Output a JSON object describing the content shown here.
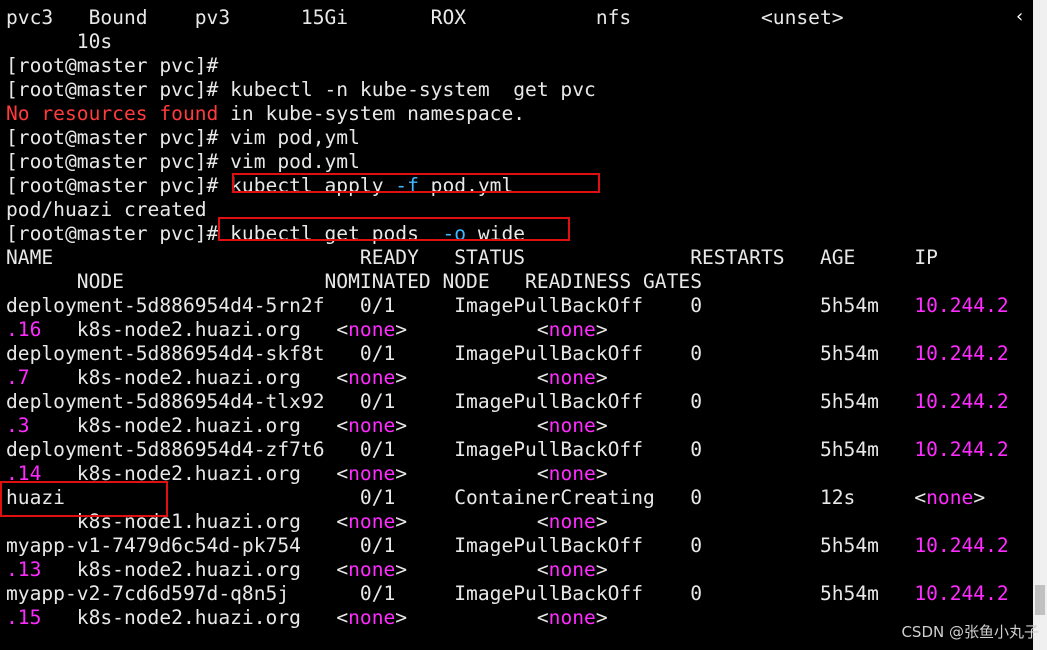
{
  "colors": {
    "background": "#000000",
    "text": "#e8e8e8",
    "error": "#ff3b3b",
    "ip_highlight": "#ff2bff",
    "flag": "#3fb8ff",
    "annotation_box": "#e01010"
  },
  "terminal": {
    "lines": {
      "l1": "pvc3   Bound    pv3      15Gi       ROX           nfs           <unset>",
      "l2": "      10s",
      "l3": "[root@master pvc]#",
      "l4": "[root@master pvc]# kubectl -n kube-system  get pvc",
      "l5_error": "No resources found",
      "l5_rest": " in kube-system namespace.",
      "l6": "[root@master pvc]# vim pod,yml",
      "l7": "[root@master pvc]# vim pod.yml",
      "l8_prompt": "[root@master pvc]# ",
      "l8_cmd1": "kubectl apply ",
      "l8_flag": "-f",
      "l8_cmd2": " pod.yml",
      "l9": "pod/huazi created",
      "l10_prompt": "[root@master pvc]# ",
      "l10_cmd1": "kubectl get pods  ",
      "l10_flag": "-o",
      "l10_cmd2": " wide",
      "h1": "NAME                          READY   STATUS              RESTARTS   AGE     IP",
      "h2": "      NODE                 NOMINATED NODE   READINESS GATES"
    },
    "pods": [
      {
        "row1": "deployment-5d886954d4-5rn2f   0/1     ImagePullBackOff    0          5h54m   ",
        "ip": "10.244.2",
        "ip_tail": ".16",
        "node": "   k8s-node2.huazi.org   ",
        "nominated": "<none>",
        "readiness": "<none>"
      },
      {
        "row1": "deployment-5d886954d4-skf8t   0/1     ImagePullBackOff    0          5h54m   ",
        "ip": "10.244.2",
        "ip_tail": ".7",
        "node": "    k8s-node2.huazi.org   ",
        "nominated": "<none>",
        "readiness": "<none>"
      },
      {
        "row1": "deployment-5d886954d4-tlx92   0/1     ImagePullBackOff    0          5h54m   ",
        "ip": "10.244.2",
        "ip_tail": ".3",
        "node": "    k8s-node2.huazi.org   ",
        "nominated": "<none>",
        "readiness": "<none>"
      },
      {
        "row1": "deployment-5d886954d4-zf7t6   0/1     ImagePullBackOff    0          5h54m   ",
        "ip": "10.244.2",
        "ip_tail": ".14",
        "node": "   k8s-node2.huazi.org   ",
        "nominated": "<none>",
        "readiness": "<none>"
      },
      {
        "row1": "huazi                         0/1     ContainerCreating   0          12s     ",
        "ip": "<none>",
        "ip_tail": "",
        "node": "      k8s-node1.huazi.org   ",
        "nominated": "<none>",
        "readiness": "<none>"
      },
      {
        "row1": "myapp-v1-7479d6c54d-pk754     0/1     ImagePullBackOff    0          5h54m   ",
        "ip": "10.244.2",
        "ip_tail": ".13",
        "node": "   k8s-node2.huazi.org   ",
        "nominated": "<none>",
        "readiness": "<none>"
      },
      {
        "row1": "myapp-v2-7cd6d597d-q8n5j      0/1     ImagePullBackOff    0          5h54m   ",
        "ip": "10.244.2",
        "ip_tail": ".15",
        "node": "   k8s-node2.huazi.org   ",
        "nominated": "<none>",
        "readiness": "<none>"
      }
    ]
  },
  "scroll_arrow": "‹",
  "watermark": "CSDN @张鱼小丸子"
}
